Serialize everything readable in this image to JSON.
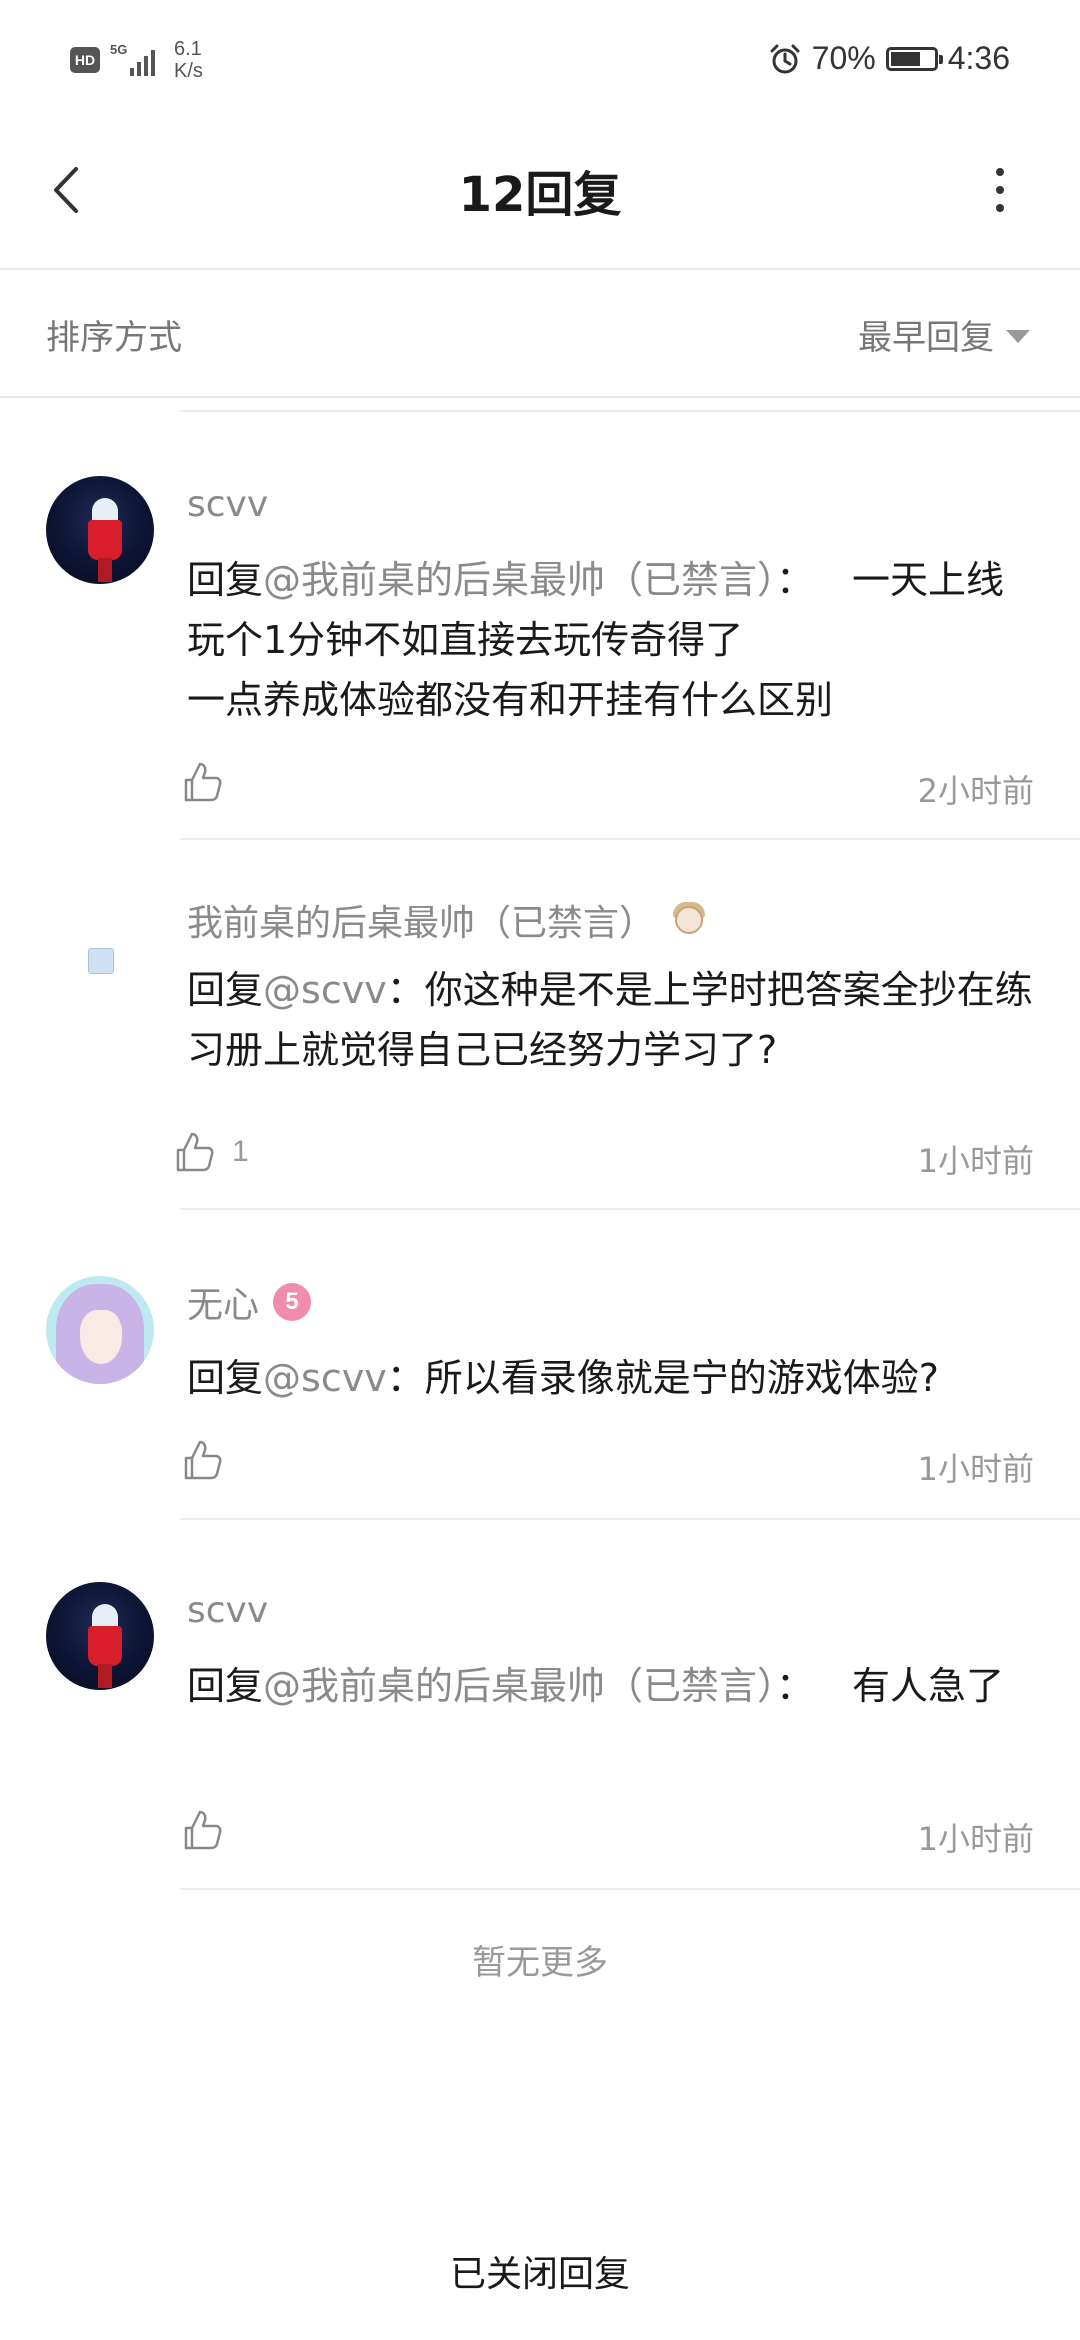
{
  "status_bar": {
    "hd": "HD",
    "network": "5G",
    "speed_value": "6.1",
    "speed_unit": "K/s",
    "battery": "70%",
    "battery_level": 0.7,
    "time": "4:36"
  },
  "header": {
    "title": "12回复"
  },
  "sort": {
    "label": "排序方式",
    "selected": "最早回复"
  },
  "replies": [
    {
      "username": "scvv",
      "reply_prefix": "回复",
      "mention": "@我前桌的后桌最帅（已禁言）",
      "separator": "：",
      "text": "一天上线玩个1分钟不如直接去玩传奇得了\n一点养成体验都没有和开挂有什么区别",
      "likes": "",
      "time": "2小时前"
    },
    {
      "username": "我前桌的后桌最帅（已禁言）",
      "reply_prefix": "回复",
      "mention": "@scvv",
      "separator": "：",
      "text": "你这种是不是上学时把答案全抄在练习册上就觉得自己已经努力学习了?",
      "likes": "1",
      "time": "1小时前"
    },
    {
      "username": "无心",
      "level": "5",
      "reply_prefix": "回复",
      "mention": "@scvv",
      "separator": "：",
      "text": "所以看录像就是宁的游戏体验?",
      "likes": "",
      "time": "1小时前"
    },
    {
      "username": "scvv",
      "reply_prefix": "回复",
      "mention": "@我前桌的后桌最帅（已禁言）",
      "separator": "：",
      "text": "有人急了",
      "likes": "",
      "time": "1小时前"
    }
  ],
  "footer": {
    "no_more": "暂无更多",
    "closed": "已关闭回复"
  },
  "colors": {
    "muted": "#8a8a8a",
    "level_badge": "#f08cb0"
  }
}
